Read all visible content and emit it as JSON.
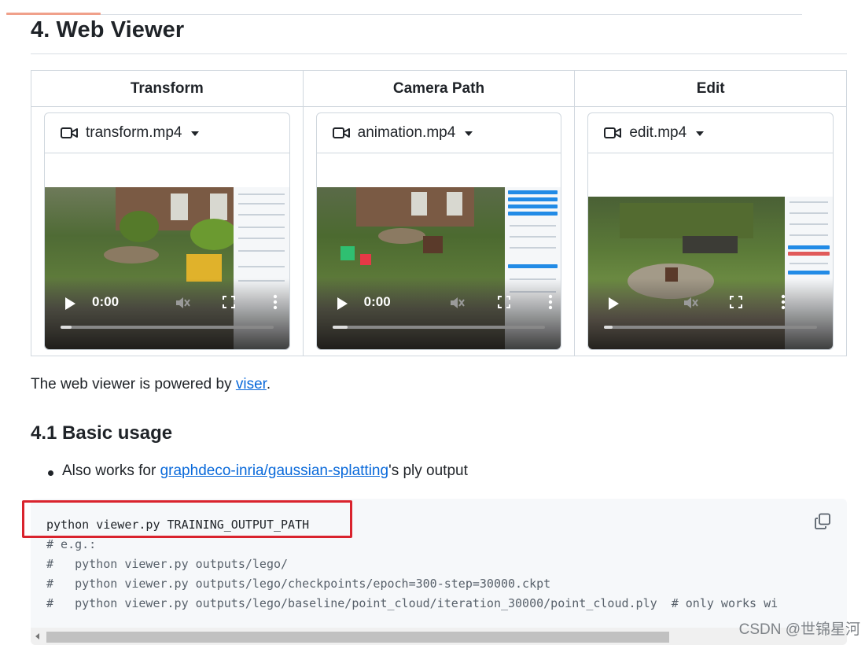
{
  "section": {
    "title": "4. Web Viewer"
  },
  "table": {
    "headers": [
      "Transform",
      "Camera Path",
      "Edit"
    ],
    "videos": [
      {
        "filename": "transform.mp4",
        "time": "0:00",
        "progress_pct": 5
      },
      {
        "filename": "animation.mp4",
        "time": "0:00",
        "progress_pct": 7
      },
      {
        "filename": "edit.mp4",
        "time": "",
        "progress_pct": 4
      }
    ]
  },
  "paragraph": {
    "prefix": "The web viewer is powered by ",
    "link_text": "viser",
    "suffix": "."
  },
  "subsection": {
    "title": "4.1 Basic usage"
  },
  "bullet": {
    "link_text": "graphdeco-inria/gaussian-splatting",
    "suffix": "'s ply output",
    "prefix": "Also works for "
  },
  "code": {
    "lines": [
      "python viewer.py TRAINING_OUTPUT_PATH",
      "# e.g.:",
      "#   python viewer.py outputs/lego/",
      "#   python viewer.py outputs/lego/checkpoints/epoch=300-step=30000.ckpt",
      "#   python viewer.py outputs/lego/baseline/point_cloud/iteration_30000/point_cloud.ply  # only works wi"
    ]
  },
  "watermark": "CSDN @世锦星河",
  "colors": {
    "link": "#0969da",
    "highlight_box": "#d9232d",
    "code_bg": "#f6f8fa",
    "border": "#d0d7de"
  }
}
